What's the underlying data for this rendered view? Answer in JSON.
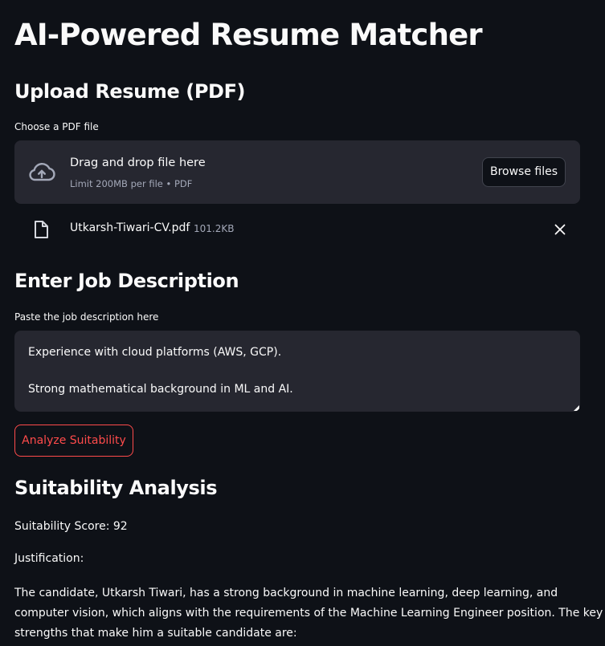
{
  "page": {
    "title": "AI-Powered Resume Matcher"
  },
  "upload": {
    "heading": "Upload Resume (PDF)",
    "label": "Choose a PDF file",
    "dropzone_text": "Drag and drop file here",
    "limit_text": "Limit 200MB per file • PDF",
    "browse_label": "Browse files",
    "file": {
      "name": "Utkarsh-Tiwari-CV.pdf",
      "size": "101.2KB"
    }
  },
  "job": {
    "heading": "Enter Job Description",
    "label": "Paste the job description here",
    "text_line1": "Experience with cloud platforms (AWS, GCP).",
    "text_line2": "Strong mathematical background in ML and AI."
  },
  "actions": {
    "analyze_label": "Analyze Suitability"
  },
  "analysis": {
    "heading": "Suitability Analysis",
    "score_text": "Suitability Score: 92",
    "justification_label": "Justification:",
    "paragraph_lines": [
      "The candidate, Utkarsh Tiwari, has a strong background in machine learning, deep learning, and",
      "computer vision, which aligns with the requirements of the Machine Learning Engineer position. The key",
      "strengths that make him a suitable candidate are:"
    ]
  },
  "colors": {
    "background": "#0e1117",
    "surface": "#262730",
    "accent": "#ff4b4b",
    "text": "#fafafa",
    "muted": "#a3a8b8"
  },
  "icons": {
    "upload": "cloud-upload-icon",
    "file": "file-icon",
    "remove": "close-icon"
  }
}
